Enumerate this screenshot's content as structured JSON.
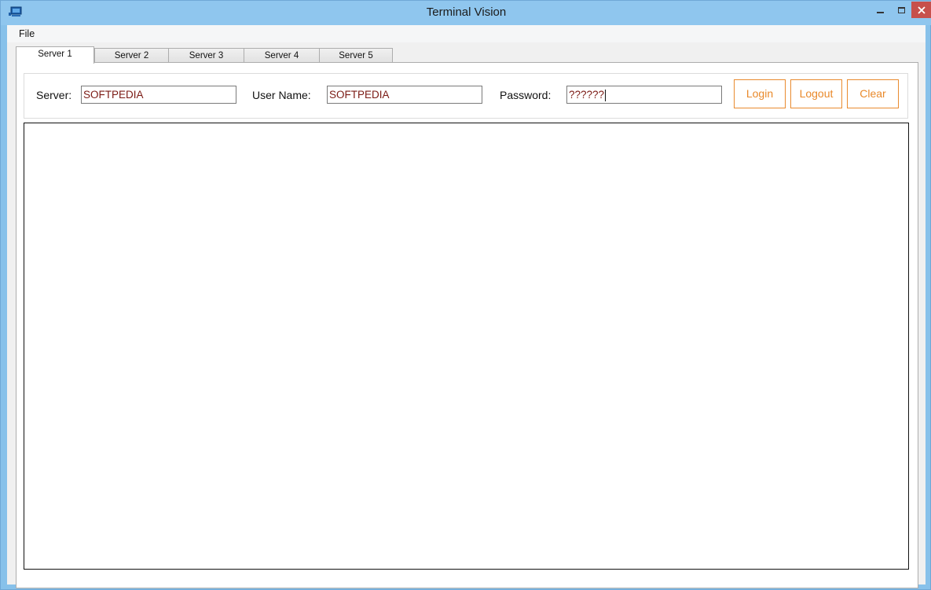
{
  "window": {
    "title": "Terminal Vision"
  },
  "menu": {
    "file_label": "File"
  },
  "tabs": [
    {
      "label": "Server 1",
      "active": true
    },
    {
      "label": "Server 2",
      "active": false
    },
    {
      "label": "Server 3",
      "active": false
    },
    {
      "label": "Server 4",
      "active": false
    },
    {
      "label": "Server 5",
      "active": false
    }
  ],
  "login": {
    "server_label": "Server:",
    "server_value": "SOFTPEDIA",
    "username_label": "User Name:",
    "username_value": "SOFTPEDIA",
    "password_label": "Password:",
    "password_value": "??????",
    "login_button": "Login",
    "logout_button": "Logout",
    "clear_button": "Clear"
  },
  "colors": {
    "accent": "#e9892a",
    "input_text": "#7b1a14",
    "close_button": "#c7504c",
    "titlebar": "#8fc6ee"
  },
  "terminal": {
    "output": ""
  }
}
